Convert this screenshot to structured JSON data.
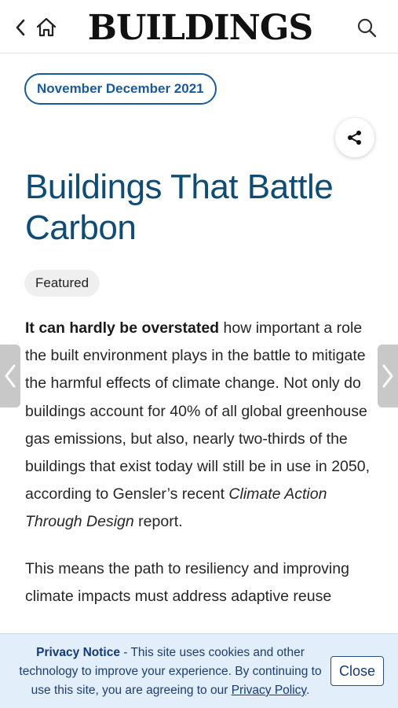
{
  "header": {
    "brand": "BUILDINGS",
    "back_icon": "chevron-left-icon",
    "home_icon": "home-icon",
    "search_icon": "search-icon"
  },
  "issue": {
    "label": "November December 2021"
  },
  "share": {
    "icon": "share-icon"
  },
  "article": {
    "title": "Buildings That Battle Carbon",
    "tag": "Featured",
    "lead_bold": "It can hardly be overstated",
    "p1_part1": " how important a role the built environment plays in the battle to mitigate the harmful effects of climate change. Not only do buildings account for 40% of all global greenhouse gas emissions, but also, nearly two-thirds of the buildings that exist today will still be in use in 2050, according to Gensler’s recent ",
    "report_title": "Climate Action Through Design",
    "p1_part2": " report.",
    "p2": "This means the path to resiliency and improving climate impacts must address adaptive reuse"
  },
  "nav": {
    "prev_icon": "chevron-left-icon",
    "next_icon": "chevron-right-icon"
  },
  "privacy": {
    "title": "Privacy Notice",
    "text": " - This site uses cookies and other technology to improve your experience. By continuing to use this site, you are agreeing to our ",
    "link": "Privacy Policy",
    "end": ".",
    "close": "Close"
  },
  "colors": {
    "accent": "#1a5a9a",
    "title": "#0f4c75",
    "privacy_bg": "#e3eefb"
  }
}
